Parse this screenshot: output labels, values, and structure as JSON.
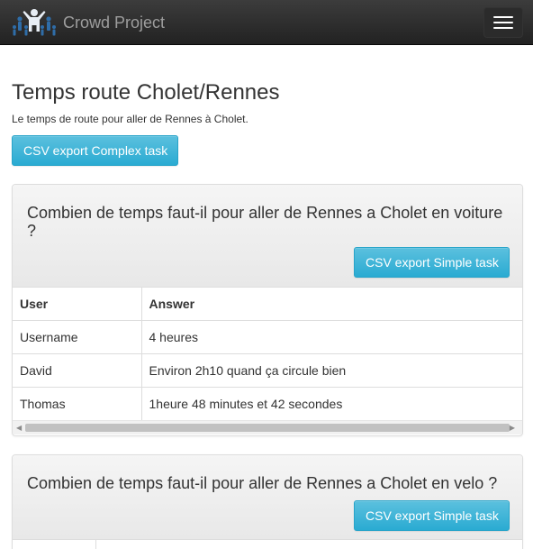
{
  "navbar": {
    "brand": "Crowd Project",
    "toggle_icon": "hamburger-menu-icon",
    "logo_icon": "crowd-logo-icon"
  },
  "page": {
    "title": "Temps route Cholet/Rennes",
    "description": "Le temps de route pour aller de Rennes à Cholet.",
    "export_complex_label": "CSV export Complex task"
  },
  "panels": [
    {
      "question": "Combien de temps faut-il pour aller de Rennes a Cholet en voiture ?",
      "export_label": "CSV export Simple task",
      "columns": [
        "User",
        "Answer"
      ],
      "rows": [
        {
          "user": "Username",
          "answer": "4 heures"
        },
        {
          "user": "David",
          "answer": "Environ 2h10 quand ça circule bien"
        },
        {
          "user": "Thomas",
          "answer": "1heure 48 minutes et 42 secondes"
        }
      ]
    },
    {
      "question": "Combien de temps faut-il pour aller de Rennes a Cholet en velo ?",
      "export_label": "CSV export Simple task"
    }
  ],
  "colors": {
    "navbar": "#222222",
    "accent": "#5bc0de",
    "brand_text": "#9d9d9d"
  }
}
